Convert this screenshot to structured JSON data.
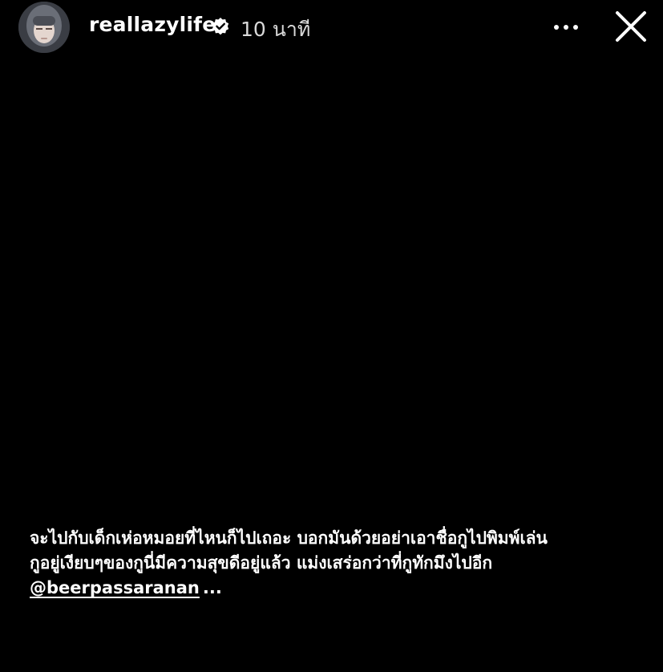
{
  "header": {
    "username": "reallazylife",
    "timestamp": "10 นาที"
  },
  "icons": {
    "verified": "verified-badge-icon",
    "more": "more-dots-icon",
    "close": "close-icon"
  },
  "caption": {
    "line1": "จะไปกับเด็กเห่อหมอยที่ไหนก็ไปเถอะ บอกมันด้วยอย่าเอาชื่อกูไปพิมพ์เล่น",
    "line2": "กูอยู่เงียบๆของกูนี่มีความสุขดีอยู่แล้ว แม่งเสร่อกว่าที่กูทักมึงไปอีก",
    "mention": "@beerpassaranan",
    "more": "..."
  },
  "colors": {
    "background": "#000000",
    "text": "#ffffff",
    "muted": "#d9d9d9"
  }
}
